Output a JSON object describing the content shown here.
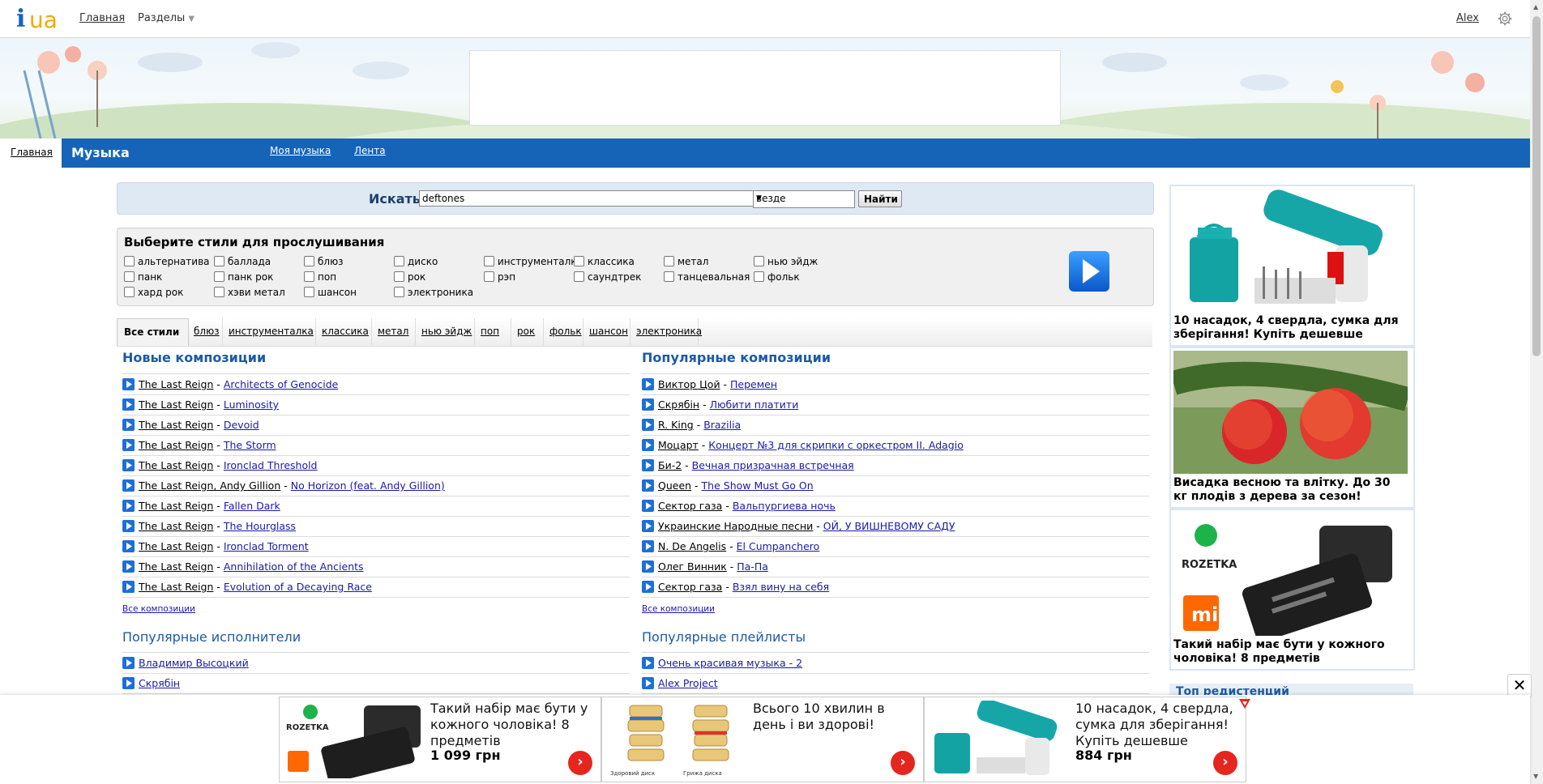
{
  "header": {
    "logo_i": "i",
    "logo_ua": "ua",
    "nav_home": "Главная",
    "nav_sections": "Разделы",
    "user_name": "Alex",
    "settings_icon": "gear-icon"
  },
  "section": {
    "title": "Музыка",
    "tabs": [
      {
        "label": "Главная",
        "active": true
      },
      {
        "label": "Моя музыка",
        "active": false
      },
      {
        "label": "Лента",
        "active": false
      }
    ]
  },
  "search": {
    "label": "Искать",
    "value": "deftones",
    "scope": "везде",
    "button": "Найти"
  },
  "styles_panel": {
    "title": "Выберите стили для прослушивания",
    "styles": [
      "альтернатива",
      "баллада",
      "блюз",
      "диско",
      "инструменталка",
      "классика",
      "метал",
      "нью эйдж",
      "панк",
      "панк рок",
      "поп",
      "рок",
      "рэп",
      "саундтрек",
      "танцевальная",
      "фольк",
      "хард рок",
      "хэви метал",
      "шансон",
      "электроника"
    ],
    "play_icon": "play-icon"
  },
  "filter_tabs": [
    {
      "label": "Все стили",
      "active": true
    },
    {
      "label": "блюз"
    },
    {
      "label": "инструменталка"
    },
    {
      "label": "классика"
    },
    {
      "label": "метал"
    },
    {
      "label": "нью эйдж"
    },
    {
      "label": "поп"
    },
    {
      "label": "рок"
    },
    {
      "label": "фольк"
    },
    {
      "label": "шансон"
    },
    {
      "label": "электроника"
    }
  ],
  "new_tracks": {
    "title": "Новые композиции",
    "items": [
      {
        "artist": "The Last Reign",
        "song": "Architects of Genocide"
      },
      {
        "artist": "The Last Reign",
        "song": "Luminosity"
      },
      {
        "artist": "The Last Reign",
        "song": "Devoid"
      },
      {
        "artist": "The Last Reign",
        "song": "The Storm"
      },
      {
        "artist": "The Last Reign",
        "song": "Ironclad Threshold"
      },
      {
        "artist": "The Last Reign, Andy Gillion",
        "song": "No Horizon (feat. Andy Gillion)"
      },
      {
        "artist": "The Last Reign",
        "song": "Fallen Dark"
      },
      {
        "artist": "The Last Reign",
        "song": "The Hourglass"
      },
      {
        "artist": "The Last Reign",
        "song": "Ironclad Torment"
      },
      {
        "artist": "The Last Reign",
        "song": "Annihilation of the Ancients"
      },
      {
        "artist": "The Last Reign",
        "song": "Evolution of a Decaying Race"
      }
    ],
    "more": "Все композиции"
  },
  "popular_tracks": {
    "title": "Популярные композиции",
    "items": [
      {
        "artist": "Виктор Цой",
        "song": "Перемен"
      },
      {
        "artist": "Скрябін",
        "song": "Любити платити"
      },
      {
        "artist": "R. King",
        "song": "Brazilia"
      },
      {
        "artist": "Моцарт",
        "song": "Концерт №3 для скрипки с оркестром II. Adagio"
      },
      {
        "artist": "Би-2",
        "song": "Вечная призрачная встречная"
      },
      {
        "artist": "Queen",
        "song": "The Show Must Go On"
      },
      {
        "artist": "Сектор газа",
        "song": "Вальпургиева ночь"
      },
      {
        "artist": "Украинские Народные песни",
        "song": "ОЙ, У ВИШНЕВОМУ САДУ"
      },
      {
        "artist": "N. De Angelis",
        "song": "El Cumpanchero"
      },
      {
        "artist": "Олег Винник",
        "song": "Па-Па"
      },
      {
        "artist": "Сектор газа",
        "song": "Взял вину на себя"
      }
    ],
    "more": "Все композиции"
  },
  "popular_artists": {
    "title": "Популярные исполнители",
    "items": [
      "Владимир Высоцкий",
      "Скрябін"
    ]
  },
  "popular_playlists": {
    "title": "Популярные плейлисты",
    "items": [
      "Очень красивая музыка - 2",
      "Alex Project"
    ]
  },
  "right_ads": [
    {
      "caption": "10 насадок, 4 свердла, сумка для зберігання! Купіть дешевше",
      "icon": "screwdriver-kit-image"
    },
    {
      "caption": "Висадка весною та влітку. До 30 кг плодів з дерева за сезон!",
      "icon": "strawberry-tree-image"
    },
    {
      "caption": "Такий набір має бути у кожного чоловіка! 8 предметів",
      "icon": "tool-case-image"
    }
  ],
  "right_ads_brand": "ROZETKA",
  "right_ads_mi": "mi",
  "top_registered": "Топ редистенций",
  "bottom_ads": [
    {
      "text": "Такий набір має бути у кожного чоловіка! 8 предметів",
      "price": "1 099 грн",
      "brand": "ROZETKA"
    },
    {
      "text": "Всього 10 хвилин в день і ви здорові!",
      "price": "",
      "cap1": "Здоровий диск",
      "cap2": "Грижа диска"
    },
    {
      "text": "10 насадок, 4 свердла, сумка для зберігання! Купіть дешевше",
      "price": "884 грн"
    }
  ],
  "colors": {
    "blue_bar": "#1664b8",
    "link": "#1a1aa6",
    "heading": "#1c5aa6"
  }
}
